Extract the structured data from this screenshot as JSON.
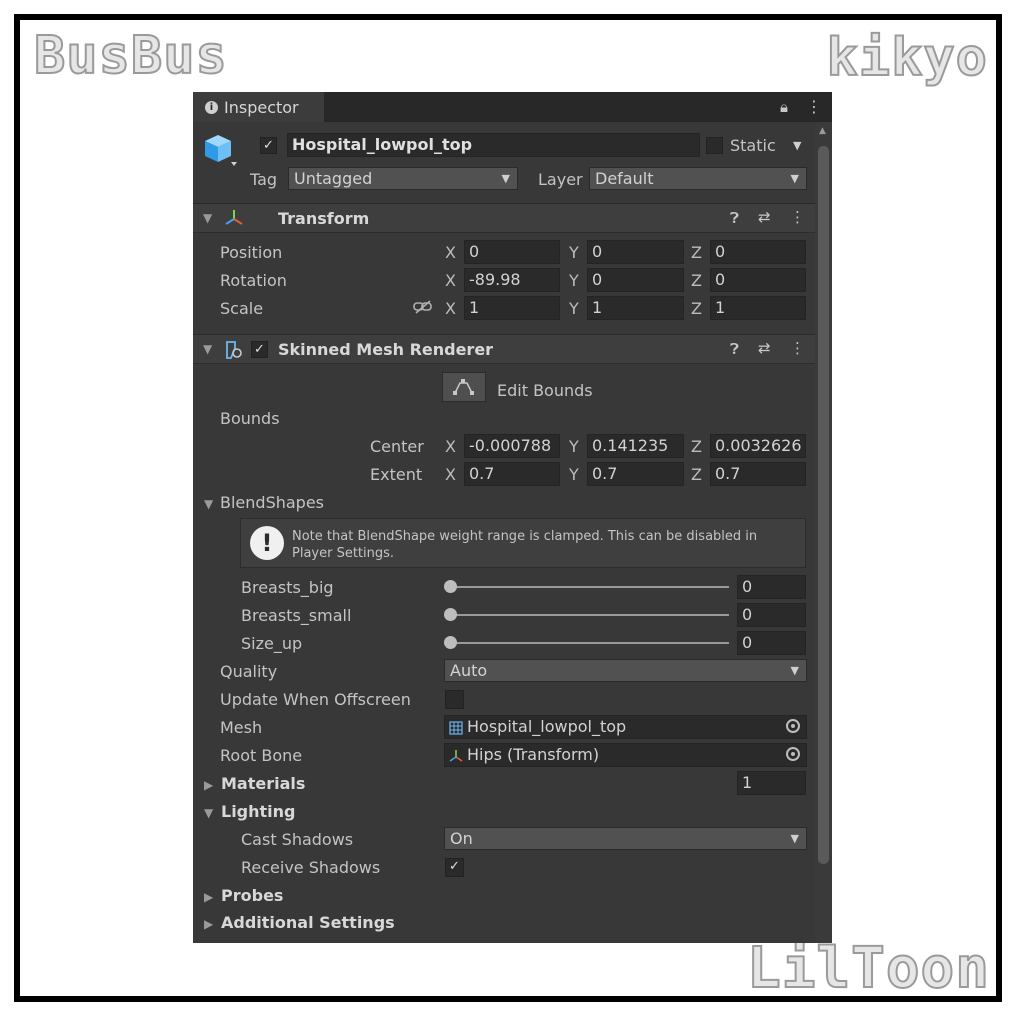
{
  "watermarks": {
    "top_left": "BusBus",
    "top_right": "kikyo",
    "bottom_right": "LilToon"
  },
  "tab": {
    "title": "Inspector"
  },
  "object": {
    "name": "Hospital_lowpol_top",
    "active": true,
    "static_label": "Static",
    "tag_label": "Tag",
    "tag_value": "Untagged",
    "layer_label": "Layer",
    "layer_value": "Default"
  },
  "transform": {
    "title": "Transform",
    "rows": [
      {
        "label": "Position",
        "x": "0",
        "y": "0",
        "z": "0"
      },
      {
        "label": "Rotation",
        "x": "-89.98",
        "y": "0",
        "z": "0"
      },
      {
        "label": "Scale",
        "x": "1",
        "y": "1",
        "z": "1"
      }
    ]
  },
  "axes": {
    "x": "X",
    "y": "Y",
    "z": "Z"
  },
  "skinned": {
    "title": "Skinned Mesh Renderer",
    "edit_bounds": "Edit Bounds",
    "bounds_label": "Bounds",
    "center": {
      "label": "Center",
      "x": "-0.000788",
      "y": "0.141235",
      "z": "0.0032626"
    },
    "extent": {
      "label": "Extent",
      "x": "0.7",
      "y": "0.7",
      "z": "0.7"
    },
    "blendshapes_label": "BlendShapes",
    "help_text": "Note that BlendShape weight range is clamped. This can be disabled in Player Settings.",
    "blendshapes": [
      {
        "name": "Breasts_big",
        "value": "0"
      },
      {
        "name": "Breasts_small",
        "value": "0"
      },
      {
        "name": "Size_up",
        "value": "0"
      }
    ],
    "quality_label": "Quality",
    "quality_value": "Auto",
    "update_offscreen_label": "Update When Offscreen",
    "mesh_label": "Mesh",
    "mesh_value": "Hospital_lowpol_top",
    "root_bone_label": "Root Bone",
    "root_bone_value": "Hips (Transform)",
    "materials_label": "Materials",
    "materials_count": "1",
    "lighting_label": "Lighting",
    "cast_shadows_label": "Cast Shadows",
    "cast_shadows_value": "On",
    "receive_shadows_label": "Receive Shadows",
    "probes_label": "Probes",
    "additional_label": "Additional Settings"
  }
}
